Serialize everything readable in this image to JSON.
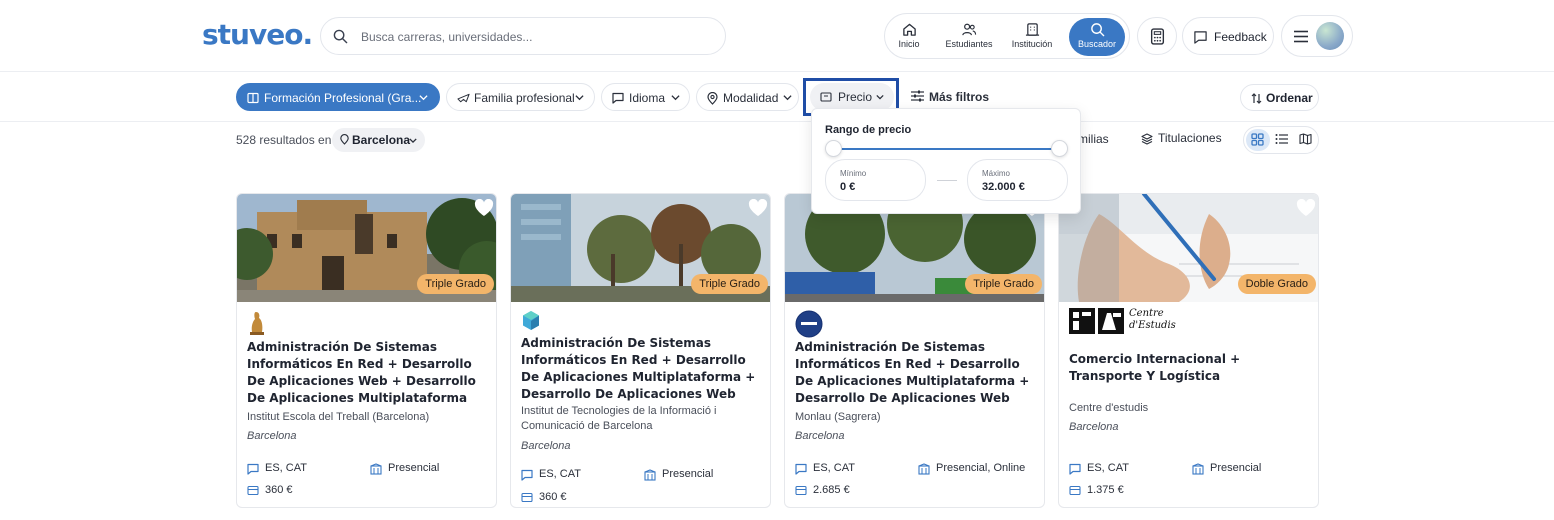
{
  "header": {
    "logo": "stuveo.",
    "search_placeholder": "Busca carreras, universidades...",
    "nav": [
      {
        "label": "Inicio",
        "icon": "home-icon"
      },
      {
        "label": "Estudiantes",
        "icon": "users-icon"
      },
      {
        "label": "Institución",
        "icon": "building-icon"
      },
      {
        "label": "Buscador",
        "icon": "search-icon"
      }
    ],
    "feedback": "Feedback"
  },
  "filters": {
    "chips": [
      "Formación Profesional (Gra...",
      "Familia profesional",
      "Idioma",
      "Modalidad",
      "Precio"
    ],
    "more_filters": "Más filtros",
    "order": "Ordenar"
  },
  "results": {
    "count_text": "528 resultados en",
    "city": "Barcelona",
    "tab_families": "milias",
    "tab_titles": "Titulaciones"
  },
  "price_dropdown": {
    "title": "Rango de precio",
    "min_label": "Mínimo",
    "min_value": "0 €",
    "max_label": "Máximo",
    "max_value": "32.000 €"
  },
  "cards": [
    {
      "badge": "Triple Grado",
      "title": "Administración De Sistemas Informáticos En Red + Desarrollo De Aplicaciones Web + Desarrollo De Aplicaciones Multiplataforma",
      "institution": "Institut Escola del Treball (Barcelona)",
      "city": "Barcelona",
      "language": "ES, CAT",
      "modality": "Presencial",
      "price": "360 €"
    },
    {
      "badge": "Triple Grado",
      "title": "Administración De Sistemas Informáticos En Red + Desarrollo De Aplicaciones Multiplataforma + Desarrollo De Aplicaciones Web",
      "institution": "Institut de Tecnologies de la Informació i Comunicació de Barcelona",
      "city": "Barcelona",
      "language": "ES, CAT",
      "modality": "Presencial",
      "price": "360 €"
    },
    {
      "badge": "Triple Grado",
      "title": "Administración De Sistemas Informáticos En Red + Desarrollo De Aplicaciones Multiplataforma + Desarrollo De Aplicaciones Web",
      "institution": "Monlau (Sagrera)",
      "city": "Barcelona",
      "language": "ES, CAT",
      "modality": "Presencial, Online",
      "price": "2.685 €"
    },
    {
      "badge": "Doble Grado",
      "title": "Comercio Internacional + Transporte Y Logística",
      "institution": "Centre d'estudis",
      "city": "Barcelona",
      "language": "ES, CAT",
      "modality": "Presencial",
      "price": "1.375 €",
      "logo_text_1": "Centre",
      "logo_text_2": "d'Estudis"
    }
  ],
  "colors": {
    "brand": "#3a78c4",
    "badge": "#f3b56a",
    "highlight_border": "#1f4da6"
  }
}
